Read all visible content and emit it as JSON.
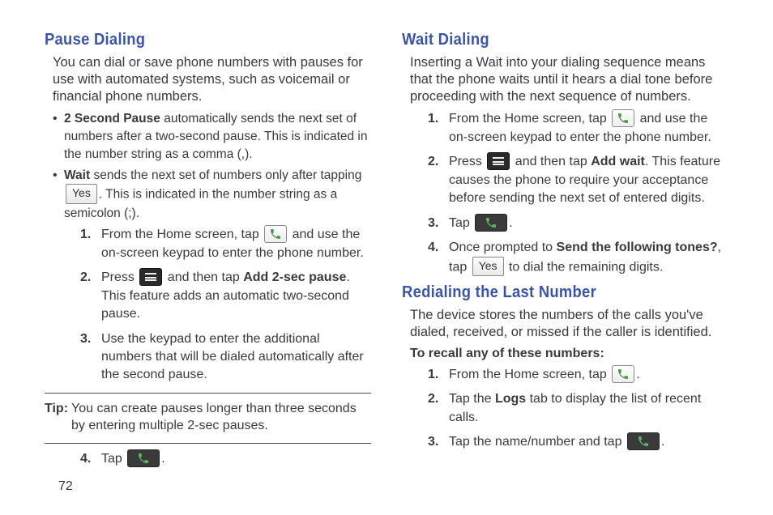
{
  "page": {
    "number": "72"
  },
  "left": {
    "h_pause": "Pause Dialing",
    "intro": "You can dial or save phone numbers with pauses for use with automated systems, such as voicemail or financial phone numbers.",
    "bullet1_strong": "2 Second Pause",
    "bullet1_rest": " automatically sends the next set of numbers after a two-second pause. This is indicated in the number string as a comma (,).",
    "bullet2_strong": "Wait",
    "bullet2_a": " sends the next set of numbers only after tapping ",
    "bullet2_yes": "Yes",
    "bullet2_b": ". This is indicated in the number string as a semicolon (;).",
    "step1_a": "From the Home screen, tap ",
    "step1_b": " and use the on-screen keypad to enter the phone number.",
    "step2_a": "Press ",
    "step2_b": " and then tap ",
    "step2_strong": "Add 2-sec pause",
    "step2_c": ". This feature adds an automatic two-second pause.",
    "step3": "Use the keypad to enter the additional numbers that will be dialed automatically after the second pause.",
    "tip_label": "Tip:",
    "tip_body": "You can create pauses longer than three seconds by entering multiple 2-sec pauses.",
    "step4_a": "Tap ",
    "step4_b": "."
  },
  "right": {
    "h_wait": "Wait Dialing",
    "intro": "Inserting a Wait into your dialing sequence means that the phone waits until it hears a dial tone before proceeding with the next sequence of numbers.",
    "step1_a": "From the Home screen, tap ",
    "step1_b": " and use the on-screen keypad to enter the phone number.",
    "step2_a": "Press ",
    "step2_b": " and then tap ",
    "step2_strong": "Add wait",
    "step2_c": ". This feature causes the phone to require your acceptance before sending the next set of entered digits.",
    "step3_a": "Tap ",
    "step3_b": ".",
    "step4_a": "Once prompted to ",
    "step4_strong": "Send the following tones?",
    "step4_b": ", tap ",
    "step4_yes": "Yes",
    "step4_c": " to dial the remaining digits.",
    "h_redial": "Redialing the Last Number",
    "redial_intro": "The device stores the numbers of the calls you've dialed, received, or missed if the caller is identified.",
    "subhead": "To recall any of these numbers:",
    "r1_a": "From the Home screen, tap ",
    "r1_b": ".",
    "r2_a": "Tap the ",
    "r2_strong": "Logs",
    "r2_b": " tab to display the list of recent calls.",
    "r3_a": "Tap the name/number and tap ",
    "r3_b": "."
  }
}
